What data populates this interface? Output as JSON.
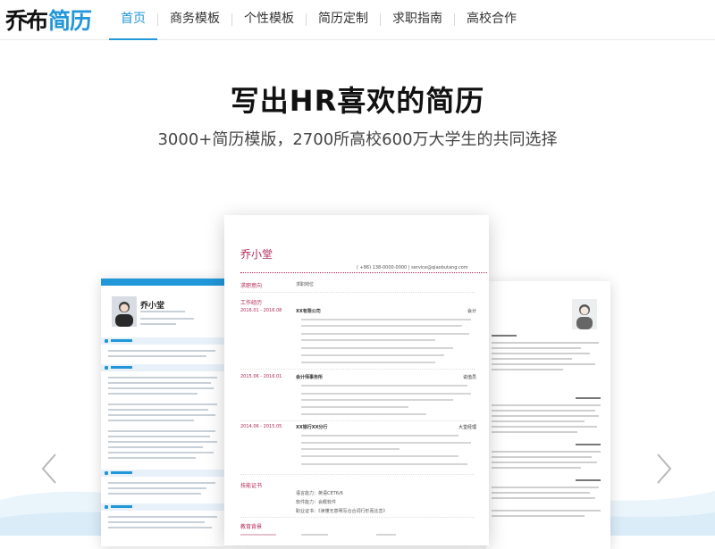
{
  "brand": {
    "logo_part1": "乔布",
    "logo_part2": "简历"
  },
  "nav": [
    {
      "label": "首页",
      "active": true
    },
    {
      "label": "商务模板",
      "active": false
    },
    {
      "label": "个性模板",
      "active": false
    },
    {
      "label": "简历定制",
      "active": false
    },
    {
      "label": "求职指南",
      "active": false
    },
    {
      "label": "高校合作",
      "active": false
    }
  ],
  "hero": {
    "title": "写出HR喜欢的简历",
    "subtitle": "3000+简历模版，2700所高校600万大学生的共同选择"
  },
  "carousel": {
    "prev_icon": "chevron-left-icon",
    "next_icon": "chevron-right-icon",
    "left_card": {
      "name": "乔小堂"
    },
    "center_card": {
      "name": "乔小堂",
      "contact": "( +86) 138-0000-0000  |  service@qiaobutang.com",
      "intent_label": "求职意向",
      "intent_value": "求职岗位",
      "work_label": "工作经历",
      "jobs": [
        {
          "date": "2016.01 - 2016.08",
          "company": "XX有限公司",
          "role": "会计"
        },
        {
          "date": "2015.06 - 2016.01",
          "company": "会计师事务所",
          "role": "说值员"
        },
        {
          "date": "2014.06 - 2015.05",
          "company": "XX银行XX分行",
          "role": "大堂经理"
        }
      ],
      "skills_label": "技能证书",
      "skills": [
        "语言能力：英语CET6/6",
        "软件能力：会概软件",
        "职业证书：《读懂无意明写合合词行形而比恋》"
      ],
      "edu_label": "教育背景"
    }
  },
  "colors": {
    "accent": "#2196d8",
    "resume_accent": "#b02a5a"
  }
}
